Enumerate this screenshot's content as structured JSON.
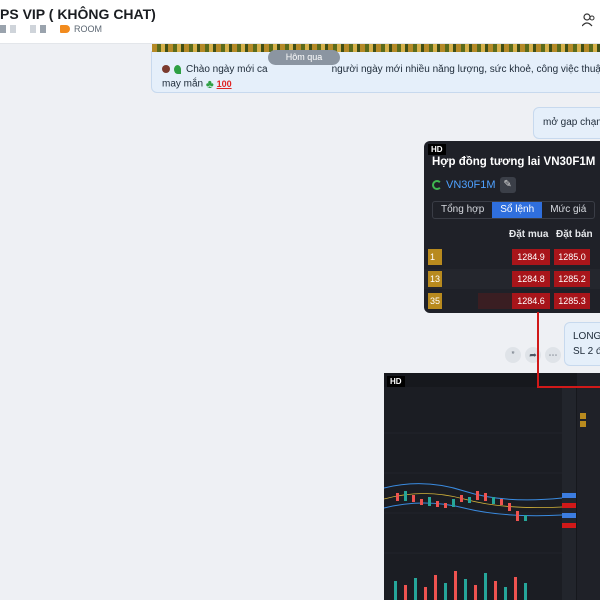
{
  "header": {
    "title": "PS VIP ( KHÔNG CHAT)",
    "room_label": "ROOM"
  },
  "date_divider": "Hôm qua",
  "message1": {
    "line1_a": "Chào ngày mới ca",
    "line1_b": "người ngày mới nhiều năng lượng, sức khoẻ, công việc thuậ",
    "line2": "may mắn"
  },
  "message2": {
    "text": "mở gap chạm"
  },
  "card": {
    "hd": "HD",
    "title": "Hợp đồng tương lai VN30F1M",
    "code": "VN30F1M",
    "tabs": [
      "Tổng hợp",
      "Sổ lệnh",
      "Mức giá"
    ],
    "active_tab": 1,
    "col_buy": "Đặt mua",
    "col_sell": "Đặt bán",
    "rows": [
      {
        "qty": "1",
        "buy": "1284.9",
        "sell": "1285.0"
      },
      {
        "qty": "13",
        "buy": "1284.8",
        "sell": "1285.2"
      },
      {
        "qty": "35",
        "buy": "1284.6",
        "sell": "1285.3"
      }
    ]
  },
  "message3": {
    "line1": "LONG",
    "line2": "SL 2 đ"
  },
  "screenshot": {
    "hd": "HD"
  },
  "colors": {
    "accent": "#2f6fde",
    "bid": "#a8151a",
    "annotation": "#d01919"
  }
}
